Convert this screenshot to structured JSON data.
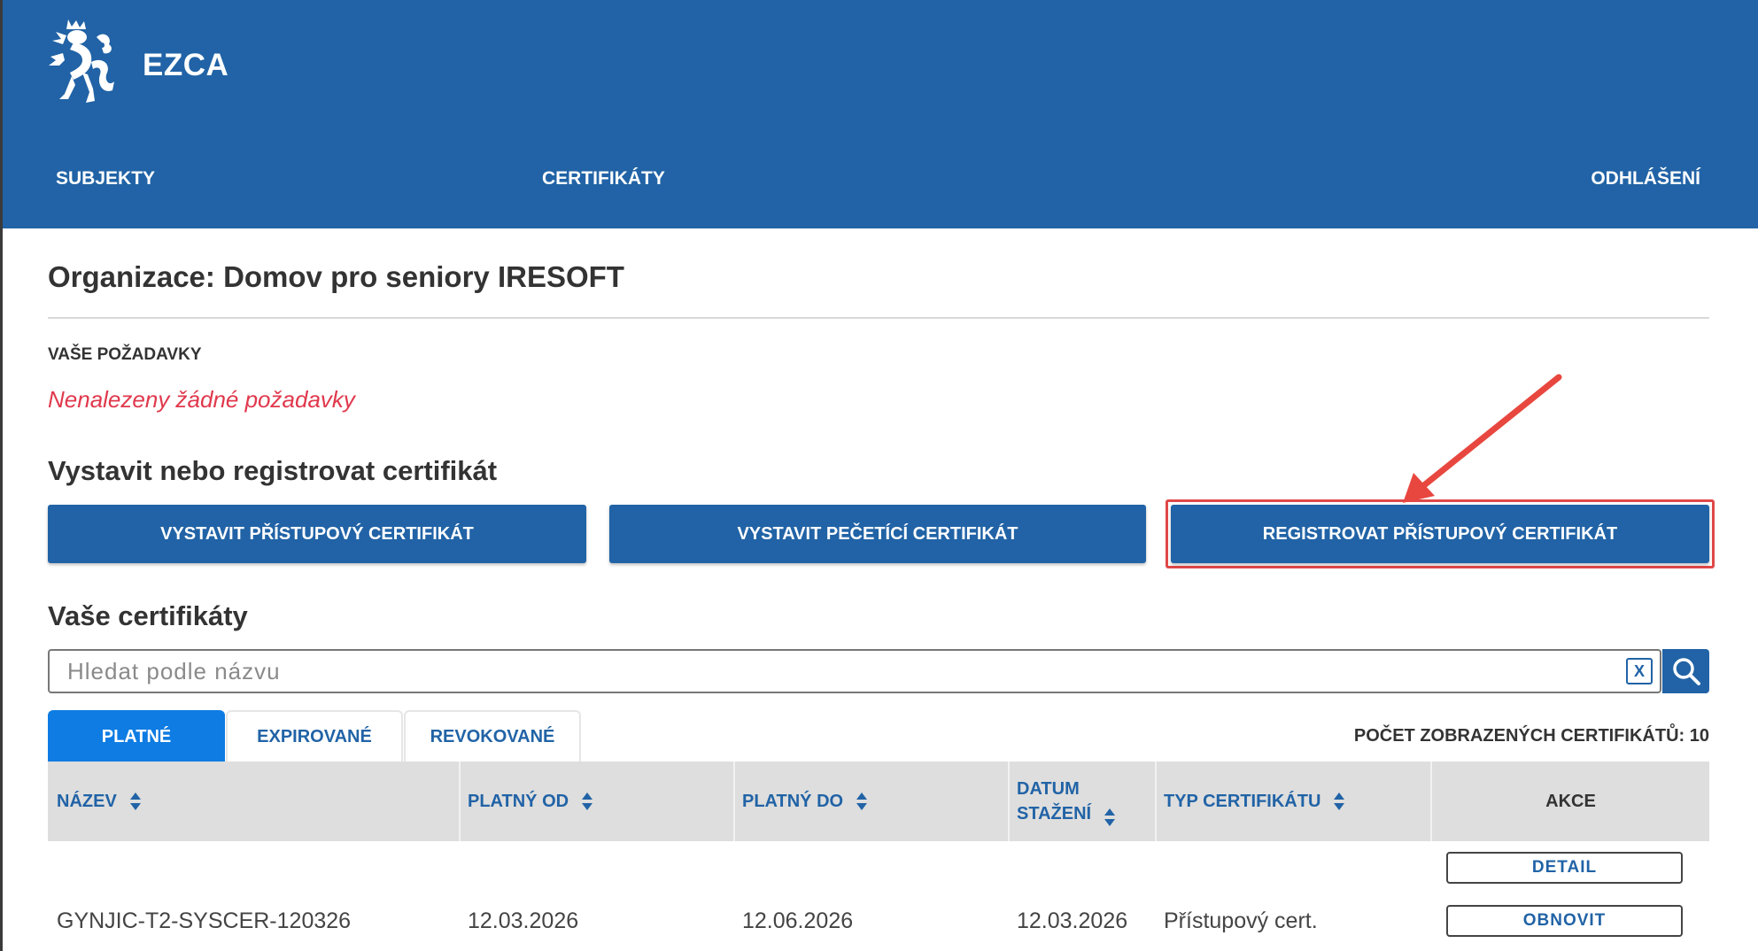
{
  "header": {
    "brand": "EZCA",
    "nav": {
      "subjekty": "SUBJEKTY",
      "certifikaty": "CERTIFIKÁTY",
      "odhlaseni": "ODHLÁŠENÍ"
    },
    "color": "#2163a6"
  },
  "organization": {
    "title": "Organizace: Domov pro seniory IRESOFT"
  },
  "requests": {
    "label": "VAŠE POŽADAVKY",
    "empty_message": "Nenalezeny žádné požadavky",
    "empty_color": "#e0384c"
  },
  "issue_section": {
    "title": "Vystavit nebo registrovat certifikát",
    "buttons": {
      "issue_access": "VYSTAVIT PŘÍSTUPOVÝ CERTIFIKÁT",
      "issue_seal": "VYSTAVIT PEČETÍCÍ CERTIFIKÁT",
      "register_access": "REGISTROVAT PŘÍSTUPOVÝ CERTIFIKÁT"
    },
    "highlight_color": "#e04848"
  },
  "certificates": {
    "title": "Vaše certifikáty",
    "search": {
      "placeholder": "Hledat podle názvu",
      "value": "",
      "clear_label": "X",
      "search_icon": "search-icon"
    },
    "tabs": {
      "platne": "PLATNÉ",
      "expirovane": "EXPIROVANÉ",
      "revokovane": "REVOKOVANÉ",
      "active": "PLATNÉ",
      "active_color": "#0e7ce3"
    },
    "count_label": "POČET ZOBRAZENÝCH CERTIFIKÁTŮ: 10",
    "columns": {
      "nazev": "NÁZEV",
      "platny_od": "PLATNÝ OD",
      "platny_do": "PLATNÝ DO",
      "datum_line1": "DATUM",
      "datum_line2": "STAŽENÍ",
      "typ": "TYP CERTIFIKÁTU",
      "akce": "AKCE"
    },
    "rows": [
      {
        "nazev": "GYNJIC-T2-SYSCER-120326",
        "platny_od": "12.03.2026",
        "platny_do": "12.06.2026",
        "datum_stazeni": "12.03.2026",
        "typ": "Přístupový cert.",
        "actions": {
          "detail": "DETAIL",
          "obnovit": "OBNOVIT"
        }
      }
    ]
  }
}
